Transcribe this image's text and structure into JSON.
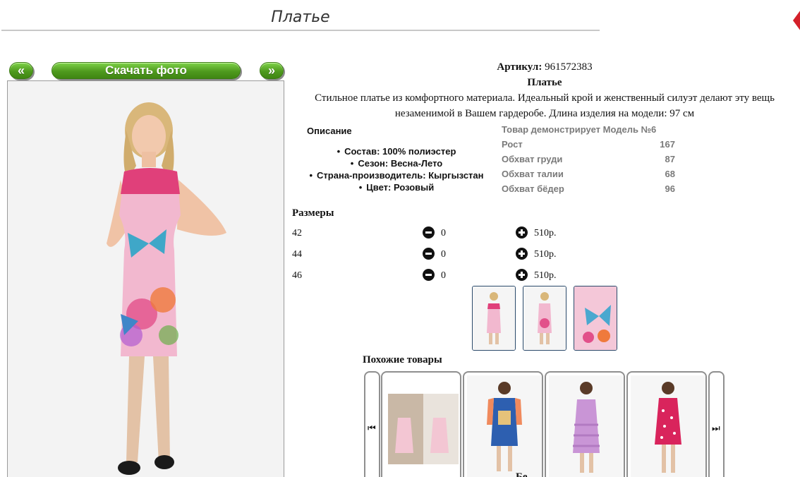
{
  "page": {
    "title": "Платье"
  },
  "photo_nav": {
    "prev_label": "«",
    "download_label": "Скачать фото",
    "next_label": "»"
  },
  "product": {
    "article_label": "Артикул:",
    "article_value": "961572383",
    "name": "Платье",
    "description": "Стильное платье из комфортного материала. Идеальный крой и женственный силуэт делают эту вещь незаменимой в Вашем гардеробе. Длина изделия на модели: 97 см"
  },
  "details": {
    "heading": "Описание",
    "items": [
      "Состав: 100% полиэстер",
      "Сезон: Весна-Лето",
      "Страна-производитель: Кыргызстан",
      "Цвет: Розовый"
    ]
  },
  "model": {
    "header": "Товар демонстрирует Модель №6",
    "rows": [
      {
        "label": "Рост",
        "value": "167"
      },
      {
        "label": "Обхват груди",
        "value": "87"
      },
      {
        "label": "Обхват талии",
        "value": "68"
      },
      {
        "label": "Обхват бёдер",
        "value": "96"
      }
    ]
  },
  "sizes": {
    "title": "Размеры",
    "rows": [
      {
        "size": "42",
        "qty": "0",
        "price": "510р."
      },
      {
        "size": "44",
        "qty": "0",
        "price": "510р."
      },
      {
        "size": "46",
        "qty": "0",
        "price": "510р."
      }
    ]
  },
  "similar": {
    "title": "Похожие товары",
    "caption": "Бе"
  },
  "colors": {
    "button_green": "#4f9a1e",
    "dress_pink": "#f2b8cf",
    "frame_blue": "#2b4a6b",
    "card_border": "#8f8f8f"
  }
}
